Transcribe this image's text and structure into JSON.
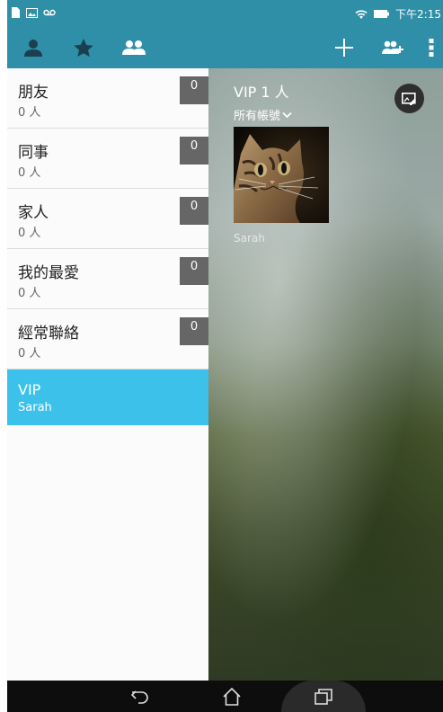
{
  "statusbar": {
    "time": "下午2:15"
  },
  "groups": [
    {
      "name": "朋友",
      "count": "0 人",
      "badge": "0"
    },
    {
      "name": "同事",
      "count": "0 人",
      "badge": "0"
    },
    {
      "name": "家人",
      "count": "0 人",
      "badge": "0"
    },
    {
      "name": "我的最愛",
      "count": "0 人",
      "badge": "0"
    },
    {
      "name": "經常聯絡",
      "count": "0 人",
      "badge": "0"
    }
  ],
  "vip_group": {
    "name": "VIP",
    "member": "Sarah"
  },
  "content": {
    "title": "VIP 1 人",
    "account_filter": "所有帳號",
    "contact_name": "Sarah"
  },
  "colors": {
    "actionbar": "#2f8fa8",
    "selected": "#3cc1eb",
    "badge": "#666666"
  }
}
